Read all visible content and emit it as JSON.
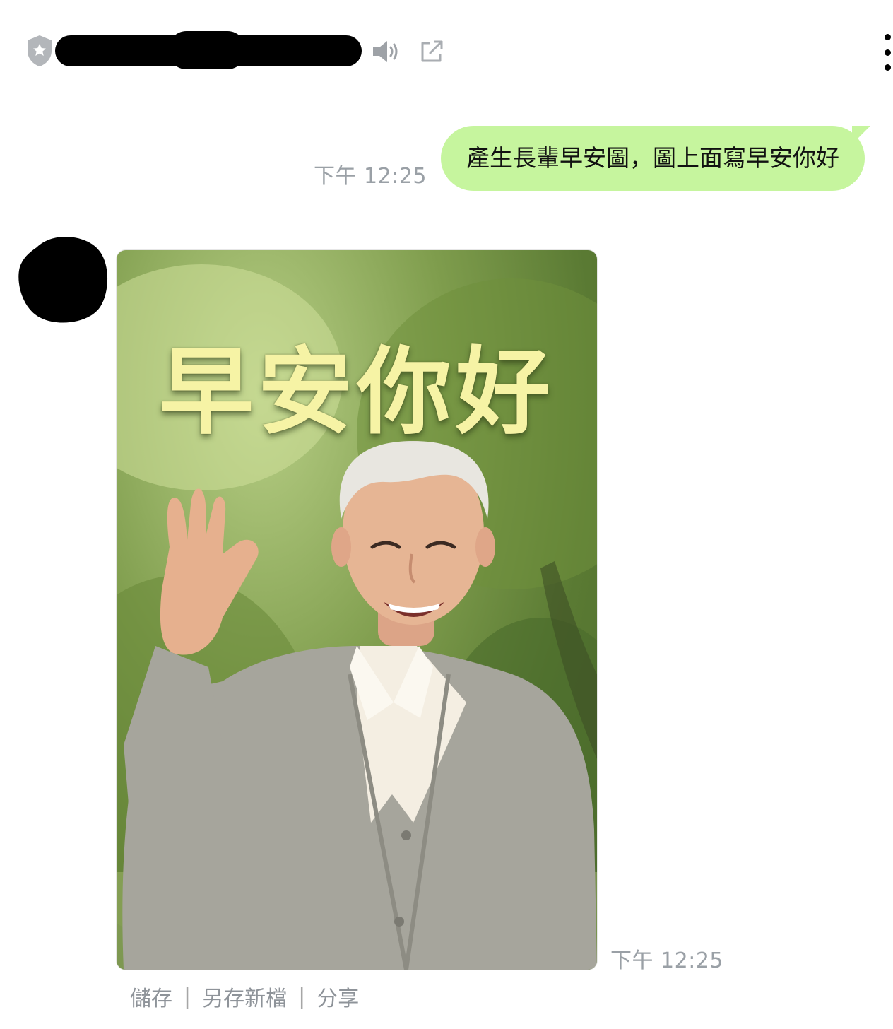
{
  "header": {
    "icons": {
      "shield": "shield-star-icon",
      "speaker": "speaker-icon",
      "external": "external-link-icon",
      "more": "more-vertical-icon"
    },
    "name_redacted": true
  },
  "messages": [
    {
      "direction": "sent",
      "text": "產生長輩早安圖，圖上面寫早安你好",
      "time": "下午 12:25"
    },
    {
      "direction": "received",
      "type": "image",
      "image_text": "早安你好",
      "time": "下午 12:25"
    }
  ],
  "image_actions": {
    "save": "儲存",
    "save_as": "另存新檔",
    "share": "分享",
    "separator": "|"
  },
  "colors": {
    "sent_bubble": "#c6f59e",
    "timestamp": "#9aa0a6",
    "caption_text": "#f6f3a5"
  }
}
